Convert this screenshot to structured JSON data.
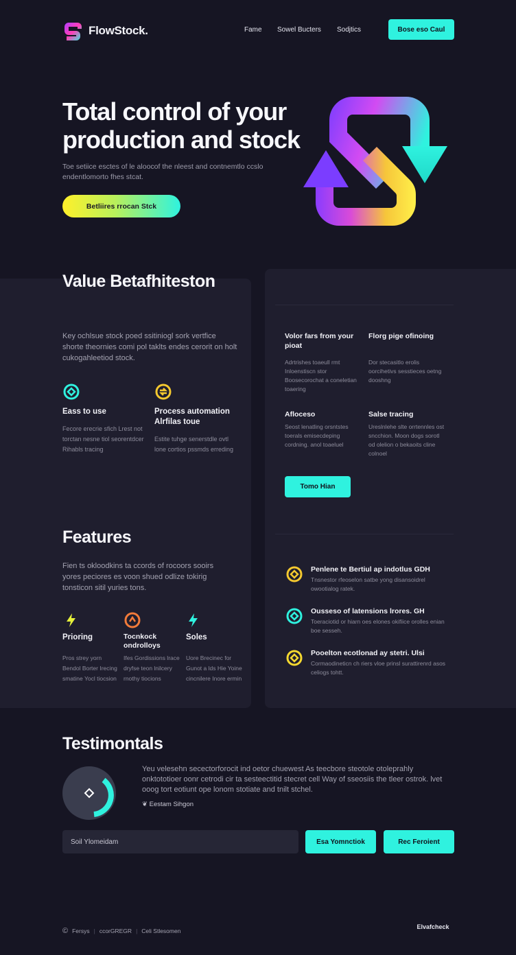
{
  "brand": {
    "name": "FlowStock."
  },
  "nav": {
    "links": [
      "Fame",
      "Sowel Bucters",
      "Sodjtics"
    ],
    "cta": "Bose eso Caul"
  },
  "hero": {
    "title": "Total control of your production and stock",
    "subtitle": "Toe setiice esctes of le aloocof the nleest and contnemtlo ccslo endentlomorto fhes stcat.",
    "button": "Betliires rrocan Stck"
  },
  "value": {
    "title": "Value Betafhiteston",
    "body": "Key ochlsue stock poed ssitiniogl sork vertfice shorte theornies comi pol taklts endes cerorit on holt cukogahleetiod stock.",
    "items": [
      {
        "title": "Eass to use",
        "desc": "Fecore erecrie sfich Lrest not torctan nesne tiol seorentdcer Rihabls tracing"
      },
      {
        "title": "Process automation Alrfilas toue",
        "desc": "Estite tuhge senerstdle ovtl lone cortios pssmds erreding"
      }
    ]
  },
  "features": {
    "title": "Features",
    "body": "Fien ts okloodkins ta ccords of rocoors sooirs yores peciores es voon shued odlize tokirig tonsticon sitil yuries tons.",
    "items": [
      {
        "title": "Prioring",
        "desc": "Pros strey yorn Bendol Borter Irecing smatine Yocl tiocsion"
      },
      {
        "title": "Tocnkock ondrolloys",
        "desc": "Ifes Gordissions lrace dryfse teon lnilcery rnothy tiocions"
      },
      {
        "title": "Soles",
        "desc": "Uore Brecinec for Gunot a lds Hie Yoine cincnilere Inore ermin"
      }
    ]
  },
  "right_top": {
    "items": [
      {
        "title": "Volor fars from your pioat",
        "desc": "Adrtrishes toaeull rmt Inloenstiscn stor Boosecorochat a coneletian toaering"
      },
      {
        "title": "Florg pige ofinoing",
        "desc": "Dor stecasitlo erolis oorcihetivs sesstieces oetng dooshng"
      },
      {
        "title": "Afloceso",
        "desc": "Seost lenatling orsntstes toerals emisecdeping cordning. anol toaeluel"
      },
      {
        "title": "Salse tracing",
        "desc": "Ureslnlehe slte orrtennles ost sncchion. Moon dogs sorotl od olelion o bekaoits cline colnoel"
      }
    ],
    "button": "Tomo Hian"
  },
  "right_list": [
    {
      "title": "Penlene te Bertiul ap indotlus GDH",
      "desc": "Tnsnestor rfeoselon satbe yong disansoidrel owootialog ratek."
    },
    {
      "title": "Ousseso of latensions lrores. GH",
      "desc": "Toeraciotid or hiarn oes elones okifiice orolles enian boe sesseh."
    },
    {
      "title": "Pooelton ecotlonad ay stetri. Ulsi",
      "desc": "Cormaodineticn ch riers vloe prinsl surattirenrd asos celiogs tohtt."
    }
  ],
  "testimonials": {
    "title": "Testimontals",
    "quote": "Yeu velesehn secectorforocit ind oetor chuewest As teecbore steotole otoleprahly onktototioer oonr cetrodi cir ta sesteectitid stecret cell Way of sseosiis the tleer ostrok. lvet ooog tort eotiunt ope lonom stotiate and tnilt stchel.",
    "author": "Eestam Sihgon",
    "email_placeholder": "Soil Ylomeidam",
    "button1": "Esa Yomnctiok",
    "button2": "Rec Feroient"
  },
  "footer": {
    "items": [
      "Fersys",
      "ccorGREGR",
      "Celi Stlesomen"
    ],
    "logo": "Elvafcheck"
  },
  "colors": {
    "background": "#161523",
    "panel": "#1f1e2e",
    "accent_teal": "#2ff2df",
    "accent_yellow": "#f5d930",
    "accent_orange": "#f27b3a"
  }
}
